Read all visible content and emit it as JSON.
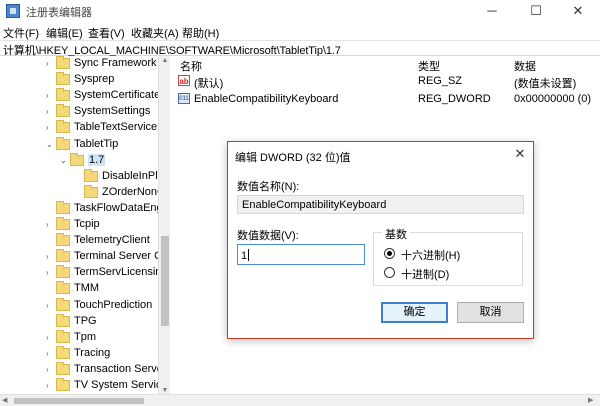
{
  "window": {
    "title": "注册表编辑器",
    "min_glyph": "─",
    "max_glyph": "☐",
    "close_glyph": "✕"
  },
  "menu": [
    "文件(F)",
    "编辑(E)",
    "查看(V)",
    "收藏夹(A)",
    "帮助(H)"
  ],
  "address": "计算机\\HKEY_LOCAL_MACHINE\\SOFTWARE\\Microsoft\\TabletTip\\1.7",
  "tree": {
    "items": [
      {
        "label": "Sync Framework",
        "level": 0,
        "expander": "›",
        "selected": false
      },
      {
        "label": "Sysprep",
        "level": 0,
        "expander": "",
        "selected": false
      },
      {
        "label": "SystemCertificates",
        "level": 0,
        "expander": "›",
        "selected": false
      },
      {
        "label": "SystemSettings",
        "level": 0,
        "expander": "›",
        "selected": false
      },
      {
        "label": "TableTextService",
        "level": 0,
        "expander": "›",
        "selected": false
      },
      {
        "label": "TabletTip",
        "level": 0,
        "expander": "⌄",
        "selected": false
      },
      {
        "label": "1.7",
        "level": 1,
        "expander": "⌄",
        "selected": true
      },
      {
        "label": "DisableInPlace",
        "level": 2,
        "expander": "",
        "selected": false
      },
      {
        "label": "ZOrderNonCore",
        "level": 2,
        "expander": "",
        "selected": false
      },
      {
        "label": "TaskFlowDataEngine",
        "level": 0,
        "expander": "",
        "selected": false
      },
      {
        "label": "Tcpip",
        "level": 0,
        "expander": "›",
        "selected": false
      },
      {
        "label": "TelemetryClient",
        "level": 0,
        "expander": "",
        "selected": false
      },
      {
        "label": "Terminal Server Client",
        "level": 0,
        "expander": "›",
        "selected": false
      },
      {
        "label": "TermServLicensing",
        "level": 0,
        "expander": "›",
        "selected": false
      },
      {
        "label": "TMM",
        "level": 0,
        "expander": "",
        "selected": false
      },
      {
        "label": "TouchPrediction",
        "level": 0,
        "expander": "›",
        "selected": false
      },
      {
        "label": "TPG",
        "level": 0,
        "expander": "",
        "selected": false
      },
      {
        "label": "Tpm",
        "level": 0,
        "expander": "›",
        "selected": false
      },
      {
        "label": "Tracing",
        "level": 0,
        "expander": "›",
        "selected": false
      },
      {
        "label": "Transaction Server",
        "level": 0,
        "expander": "›",
        "selected": false
      },
      {
        "label": "TV System Services",
        "level": 0,
        "expander": "›",
        "selected": false
      }
    ]
  },
  "values": {
    "headers": {
      "name": "名称",
      "type": "类型",
      "data": "数据"
    },
    "rows": [
      {
        "icon": "string-value-icon",
        "icon_text": "ab",
        "name": "(默认)",
        "type": "REG_SZ",
        "data": "(数值未设置)"
      },
      {
        "icon": "dword-value-icon",
        "icon_text": "011",
        "name": "EnableCompatibilityKeyboard",
        "type": "REG_DWORD",
        "data": "0x00000000 (0)"
      }
    ]
  },
  "dialog": {
    "title": "编辑 DWORD (32 位)值",
    "close_glyph": "✕",
    "name_label": "数值名称(N):",
    "name_value": "EnableCompatibilityKeyboard",
    "data_label": "数值数据(V):",
    "data_value": "1",
    "base_label": "基数",
    "base_options": [
      {
        "label": "十六进制(H)",
        "checked": true
      },
      {
        "label": "十进制(D)",
        "checked": false
      }
    ],
    "ok": "确定",
    "cancel": "取消"
  },
  "colors": {
    "selection": "#cce4f7",
    "dialog_border": "#c53a2f",
    "primary_button_border": "#3c7fd0",
    "folder": "#f4d87a"
  }
}
